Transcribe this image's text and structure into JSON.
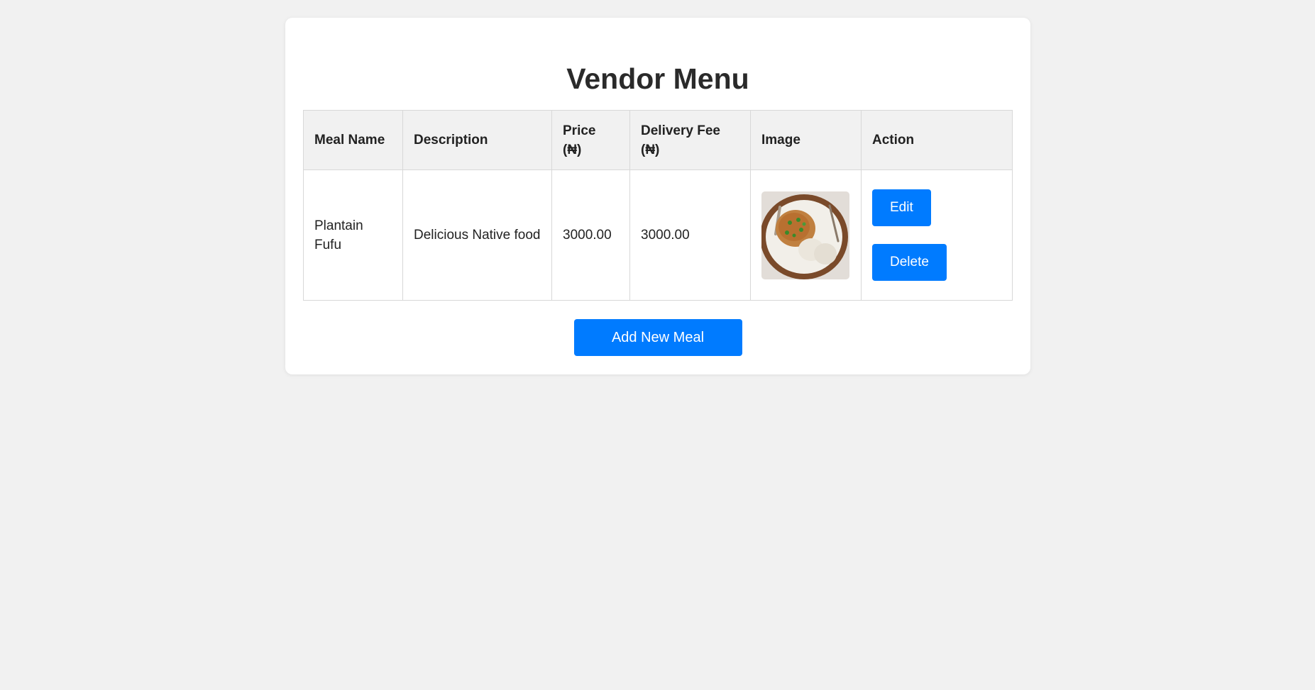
{
  "page": {
    "title": "Vendor Menu"
  },
  "table": {
    "headers": {
      "meal_name": "Meal Name",
      "description": "Description",
      "price_line1": "Price",
      "price_line2": "(₦)",
      "delivery_line1": "Delivery Fee",
      "delivery_line2": "(₦)",
      "image": "Image",
      "action": "Action"
    },
    "rows": [
      {
        "meal_name": "Plantain Fufu",
        "description": "Delicious Native food",
        "price": "3000.00",
        "delivery_fee": "3000.00",
        "image_alt": "Plantain Fufu",
        "edit_label": "Edit",
        "delete_label": "Delete"
      }
    ]
  },
  "actions": {
    "add_label": "Add New Meal"
  },
  "colors": {
    "accent": "#007bff",
    "background": "#f1f1f1",
    "card": "#ffffff"
  }
}
